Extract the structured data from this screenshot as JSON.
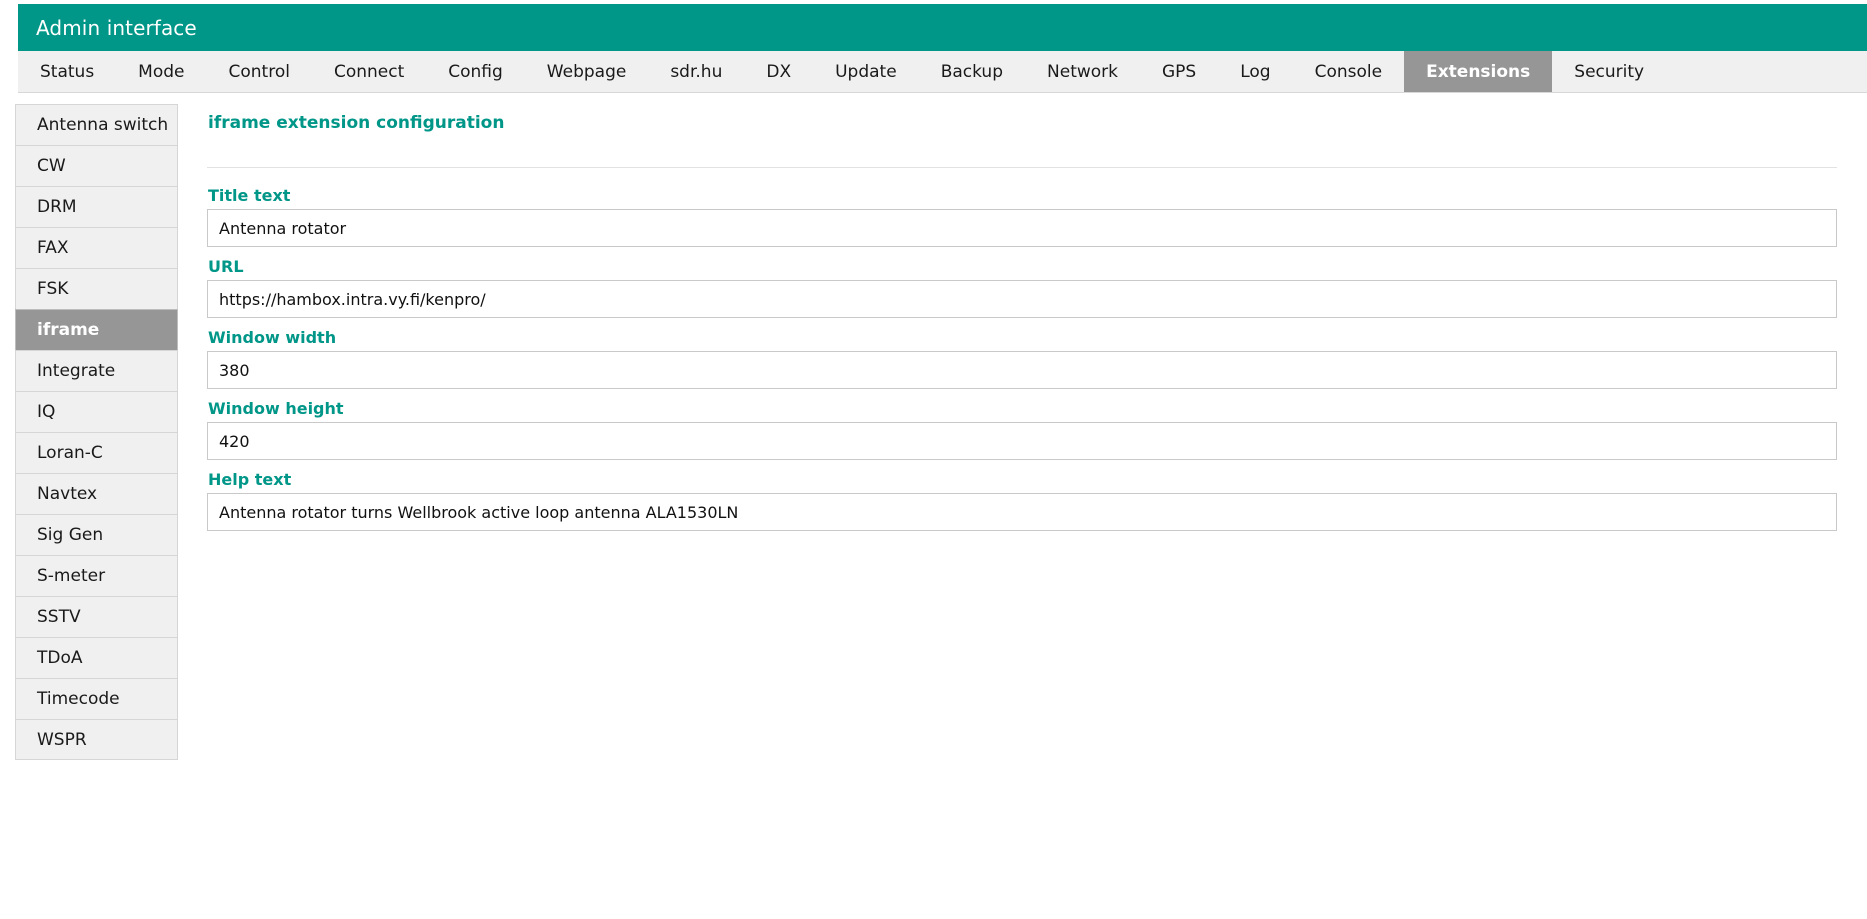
{
  "header": {
    "title": "Admin interface",
    "accent_color": "#009688"
  },
  "nav": {
    "active": "Extensions",
    "active_bg": "#969696",
    "tabs": [
      {
        "label": "Status"
      },
      {
        "label": "Mode"
      },
      {
        "label": "Control"
      },
      {
        "label": "Connect"
      },
      {
        "label": "Config"
      },
      {
        "label": "Webpage"
      },
      {
        "label": "sdr.hu"
      },
      {
        "label": "DX"
      },
      {
        "label": "Update"
      },
      {
        "label": "Backup"
      },
      {
        "label": "Network"
      },
      {
        "label": "GPS"
      },
      {
        "label": "Log"
      },
      {
        "label": "Console"
      },
      {
        "label": "Extensions"
      },
      {
        "label": "Security"
      }
    ]
  },
  "sidebar": {
    "active": "iframe",
    "items": [
      {
        "label": "Antenna switch"
      },
      {
        "label": "CW"
      },
      {
        "label": "DRM"
      },
      {
        "label": "FAX"
      },
      {
        "label": "FSK"
      },
      {
        "label": "iframe"
      },
      {
        "label": "Integrate"
      },
      {
        "label": "IQ"
      },
      {
        "label": "Loran-C"
      },
      {
        "label": "Navtex"
      },
      {
        "label": "Sig Gen"
      },
      {
        "label": "S-meter"
      },
      {
        "label": "SSTV"
      },
      {
        "label": "TDoA"
      },
      {
        "label": "Timecode"
      },
      {
        "label": "WSPR"
      }
    ]
  },
  "main": {
    "title": "iframe extension configuration",
    "fields": [
      {
        "label": "Title text",
        "value": "Antenna rotator",
        "placeholder": ""
      },
      {
        "label": "URL",
        "value": "https://hambox.intra.vy.fi/kenpro/",
        "placeholder": ""
      },
      {
        "label": "Window width",
        "value": "380",
        "placeholder": ""
      },
      {
        "label": "Window height",
        "value": "420",
        "placeholder": ""
      },
      {
        "label": "Help text",
        "value": "Antenna rotator turns Wellbrook active loop antenna ALA1530LN",
        "placeholder": ""
      }
    ]
  }
}
